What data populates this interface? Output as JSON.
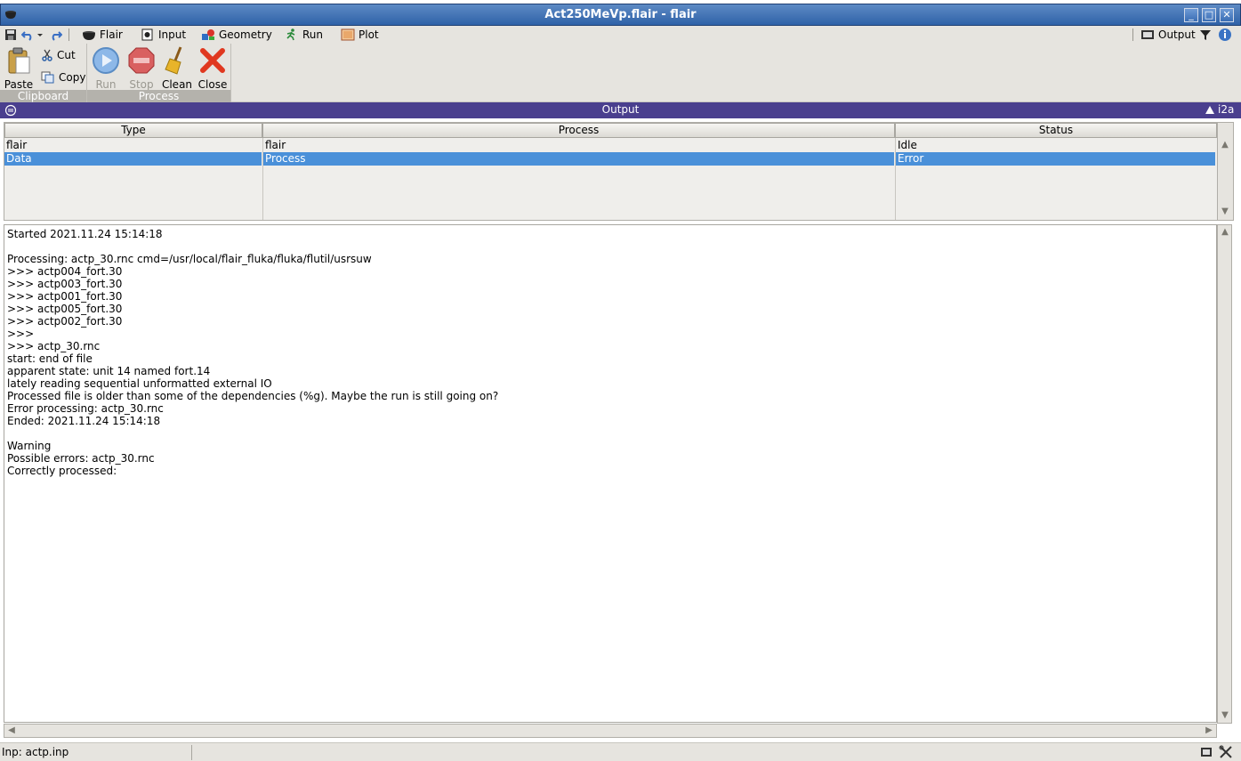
{
  "window": {
    "title": "Act250MeVp.flair - flair",
    "controls": {
      "minimize": "_",
      "maximize": "□",
      "close": "✕"
    }
  },
  "menu": {
    "items": [
      {
        "label": "Flair",
        "icon": "cauldron-icon"
      },
      {
        "label": "Input",
        "icon": "input-card-icon"
      },
      {
        "label": "Geometry",
        "icon": "geometry-shapes-icon"
      },
      {
        "label": "Run",
        "icon": "runner-icon"
      },
      {
        "label": "Plot",
        "icon": "plot-frame-icon"
      }
    ],
    "output_button": "Output"
  },
  "ribbon": {
    "clipboard": {
      "group_label": "Clipboard",
      "paste": "Paste",
      "cut": "Cut",
      "copy": "Copy"
    },
    "process": {
      "group_label": "Process",
      "run": "Run",
      "stop": "Stop",
      "clean": "Clean",
      "close": "Close"
    }
  },
  "output_panel": {
    "title": "Output",
    "corner_label": "i2a"
  },
  "table": {
    "columns": [
      "Type",
      "Process",
      "Status"
    ],
    "rows": [
      {
        "type": "flair",
        "process": "flair",
        "status": "Idle",
        "selected": false
      },
      {
        "type": "Data",
        "process": "Process",
        "status": "Error",
        "selected": true
      }
    ]
  },
  "log": {
    "lines": [
      "Started 2021.11.24 15:14:18",
      "",
      "Processing: actp_30.rnc cmd=/usr/local/flair_fluka/fluka/flutil/usrsuw",
      ">>> actp004_fort.30",
      ">>> actp003_fort.30",
      ">>> actp001_fort.30",
      ">>> actp005_fort.30",
      ">>> actp002_fort.30",
      ">>>",
      ">>> actp_30.rnc",
      "start: end of file",
      "apparent state: unit 14 named fort.14",
      "lately reading sequential unformatted external IO",
      "Processed file is older than some of the dependencies (%g). Maybe the run is still going on?",
      "Error processing: actp_30.rnc",
      "Ended: 2021.11.24 15:14:18",
      "",
      "Warning",
      "Possible errors: actp_30.rnc",
      "Correctly processed:"
    ]
  },
  "statusbar": {
    "input_file": "Inp: actp.inp"
  },
  "colors": {
    "title_bar": "#2f62a8",
    "output_bar": "#4a3f8e",
    "selection": "#4a90d9"
  }
}
